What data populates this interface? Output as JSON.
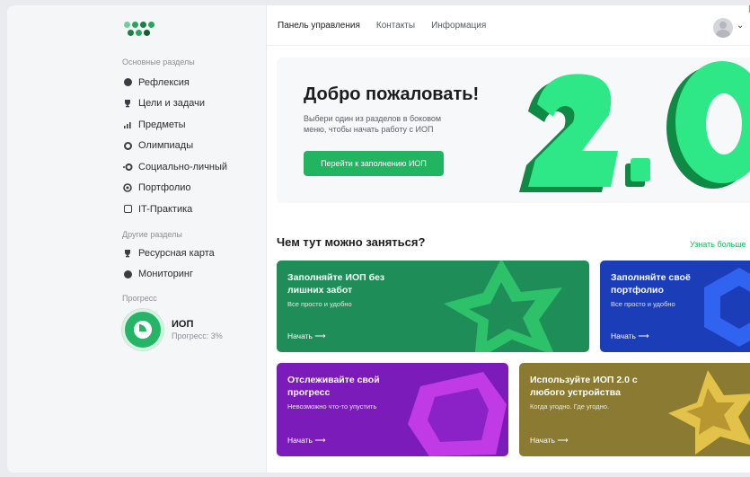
{
  "colors": {
    "accent": "#21b461",
    "sidebar_bg": "#f5f6f8",
    "card_green": "#1f8d57",
    "card_blue": "#1c3db8",
    "card_purple": "#7b1bb9",
    "card_gold": "#8a7a32"
  },
  "sidebar": {
    "main_section_label": "Основные разделы",
    "main_items": [
      {
        "label": "Рефлексия",
        "icon": "disc-icon"
      },
      {
        "label": "Цели и задачи",
        "icon": "trophy-icon"
      },
      {
        "label": "Предметы",
        "icon": "bar-chart-icon"
      },
      {
        "label": "Олимпиады",
        "icon": "ring-icon"
      },
      {
        "label": "Социально-личный",
        "icon": "social-icon"
      },
      {
        "label": "Портфолио",
        "icon": "portfolio-icon"
      },
      {
        "label": "IT-Практика",
        "icon": "code-window-icon"
      }
    ],
    "other_section_label": "Другие разделы",
    "other_items": [
      {
        "label": "Ресурсная карта",
        "icon": "trophy-icon"
      },
      {
        "label": "Мониторинг",
        "icon": "monitor-icon"
      }
    ],
    "progress_section_label": "Прогресс",
    "progress": {
      "title": "ИОП",
      "subtitle": "Прогресс: 3%",
      "percent": 3
    }
  },
  "header": {
    "tabs": [
      {
        "label": "Панель управления",
        "active": true
      },
      {
        "label": "Контакты",
        "active": false
      },
      {
        "label": "Информация",
        "active": false
      }
    ]
  },
  "hero": {
    "title": "Добро пожаловать!",
    "text": "Выбери один из разделов в боковом меню, чтобы начать работу с ИОП",
    "button": "Перейти к заполнению ИОП"
  },
  "activities": {
    "title": "Чем тут можно заняться?",
    "more_link": "Узнать больше",
    "cards": [
      {
        "title": "Заполняйте ИОП без лишних забот",
        "subtitle": "Все просто и удобно",
        "start": "Начать ⟶"
      },
      {
        "title": "Заполняйте своё портфолио",
        "subtitle": "Все просто и удобно",
        "start": "Начать ⟶"
      },
      {
        "title": "Отслеживайте свой прогресс",
        "subtitle": "Невозможно что-то упустить",
        "start": "Начать ⟶"
      },
      {
        "title": "Используйте ИОП 2.0 с любого устройства",
        "subtitle": "Когда угодно. Где угодно.",
        "start": "Начать ⟶"
      }
    ]
  }
}
